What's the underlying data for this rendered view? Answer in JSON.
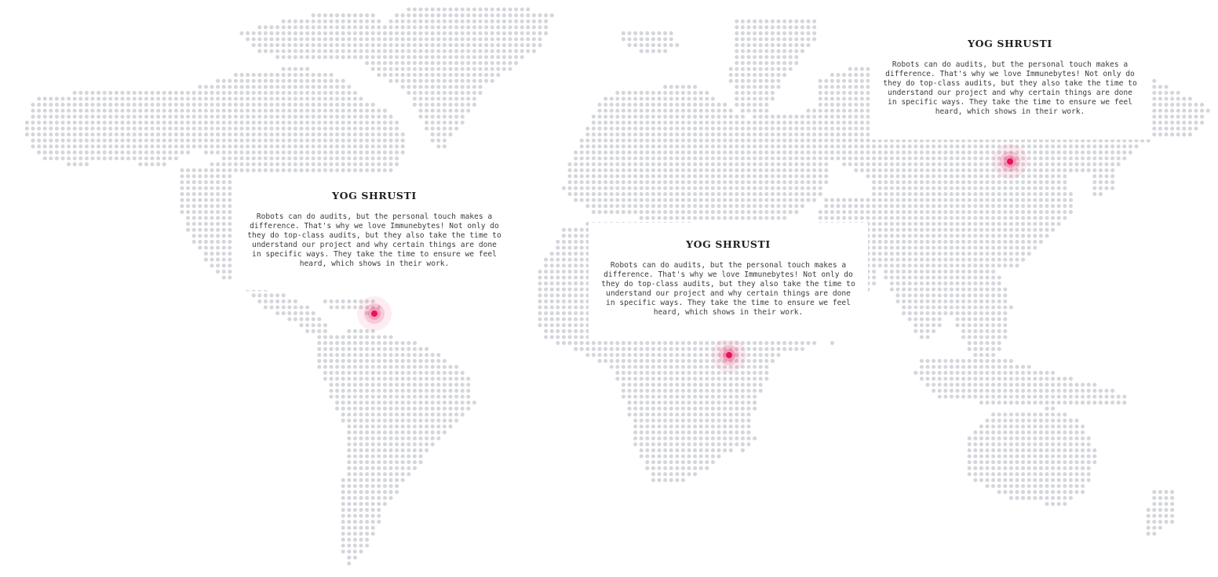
{
  "map": {
    "dot_color": "#d4d6dc",
    "pin_color": "#e8125c",
    "pin_icon": "location-pulse-icon"
  },
  "testimonials": [
    {
      "name": "YOG SHRUSTI",
      "body": "Robots can do audits, but the personal touch makes a difference. That's why we love Immunebytes! Not only do they do top-class audits, but they also take the time to understand our project and why certain things are done in specific ways. They take the time to ensure we feel heard, which shows in their work."
    },
    {
      "name": "YOG SHRUSTI",
      "body": "Robots can do audits, but the personal touch makes a difference. That's why we love Immunebytes! Not only do they do top-class audits, but they also take the time to understand our project and why certain things are done in specific ways. They take the time to ensure we feel heard, which shows in their work."
    },
    {
      "name": "YOG SHRUSTI",
      "body": "Robots can do audits, but the personal touch makes a difference. That's why we love Immunebytes! Not only do they do top-class audits, but they also take the time to understand our project and why certain things are done in specific ways. They take the time to ensure we feel heard, which shows in their work."
    }
  ]
}
